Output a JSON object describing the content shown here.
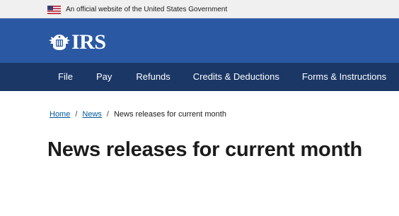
{
  "gov_banner": {
    "text": "An official website of the United States Government"
  },
  "header": {
    "logo_text": "IRS"
  },
  "nav": {
    "items": [
      {
        "label": "File"
      },
      {
        "label": "Pay"
      },
      {
        "label": "Refunds"
      },
      {
        "label": "Credits & Deductions"
      },
      {
        "label": "Forms & Instructions"
      }
    ]
  },
  "breadcrumb": {
    "items": [
      {
        "label": "Home"
      },
      {
        "label": "News"
      },
      {
        "label": "News releases for current month"
      }
    ],
    "separator": "/"
  },
  "main": {
    "title": "News releases for current month"
  },
  "colors": {
    "banner_bg": "#f0f0f0",
    "logo_bar_bg": "#2a58a3",
    "nav_bg": "#1a3766",
    "link": "#00599c",
    "text": "#1b1b1b"
  },
  "icons": {
    "flag": "us-flag-icon",
    "logo": "irs-eagle-icon"
  }
}
